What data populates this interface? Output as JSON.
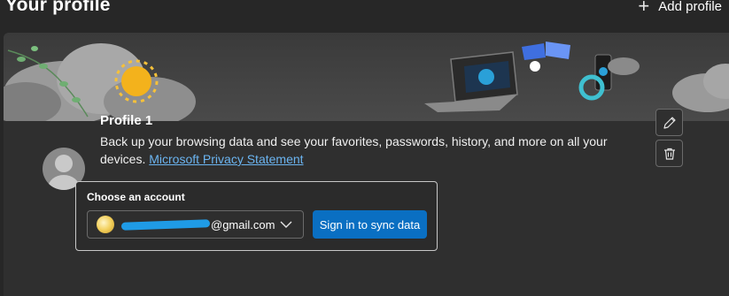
{
  "header": {
    "title": "Your profile",
    "add_profile_label": "Add profile",
    "add_icon": "plus-icon"
  },
  "profile": {
    "name": "Profile 1",
    "description": "Back up your browsing data and see your favorites, passwords, history, and more on all your devices.",
    "privacy_link": "Microsoft Privacy Statement",
    "avatar_icon": "person-avatar-icon",
    "actions": {
      "edit_icon": "pencil-icon",
      "delete_icon": "trash-icon"
    }
  },
  "account": {
    "label": "Choose an account",
    "selected_email": "@gmail.com",
    "dropdown_icon": "chevron-down-icon",
    "sync_button": "Sign in to sync data"
  },
  "colors": {
    "background": "#272727",
    "card": "#2f2f2f",
    "accent": "#0a6fc2",
    "link": "#6bb4f0"
  }
}
